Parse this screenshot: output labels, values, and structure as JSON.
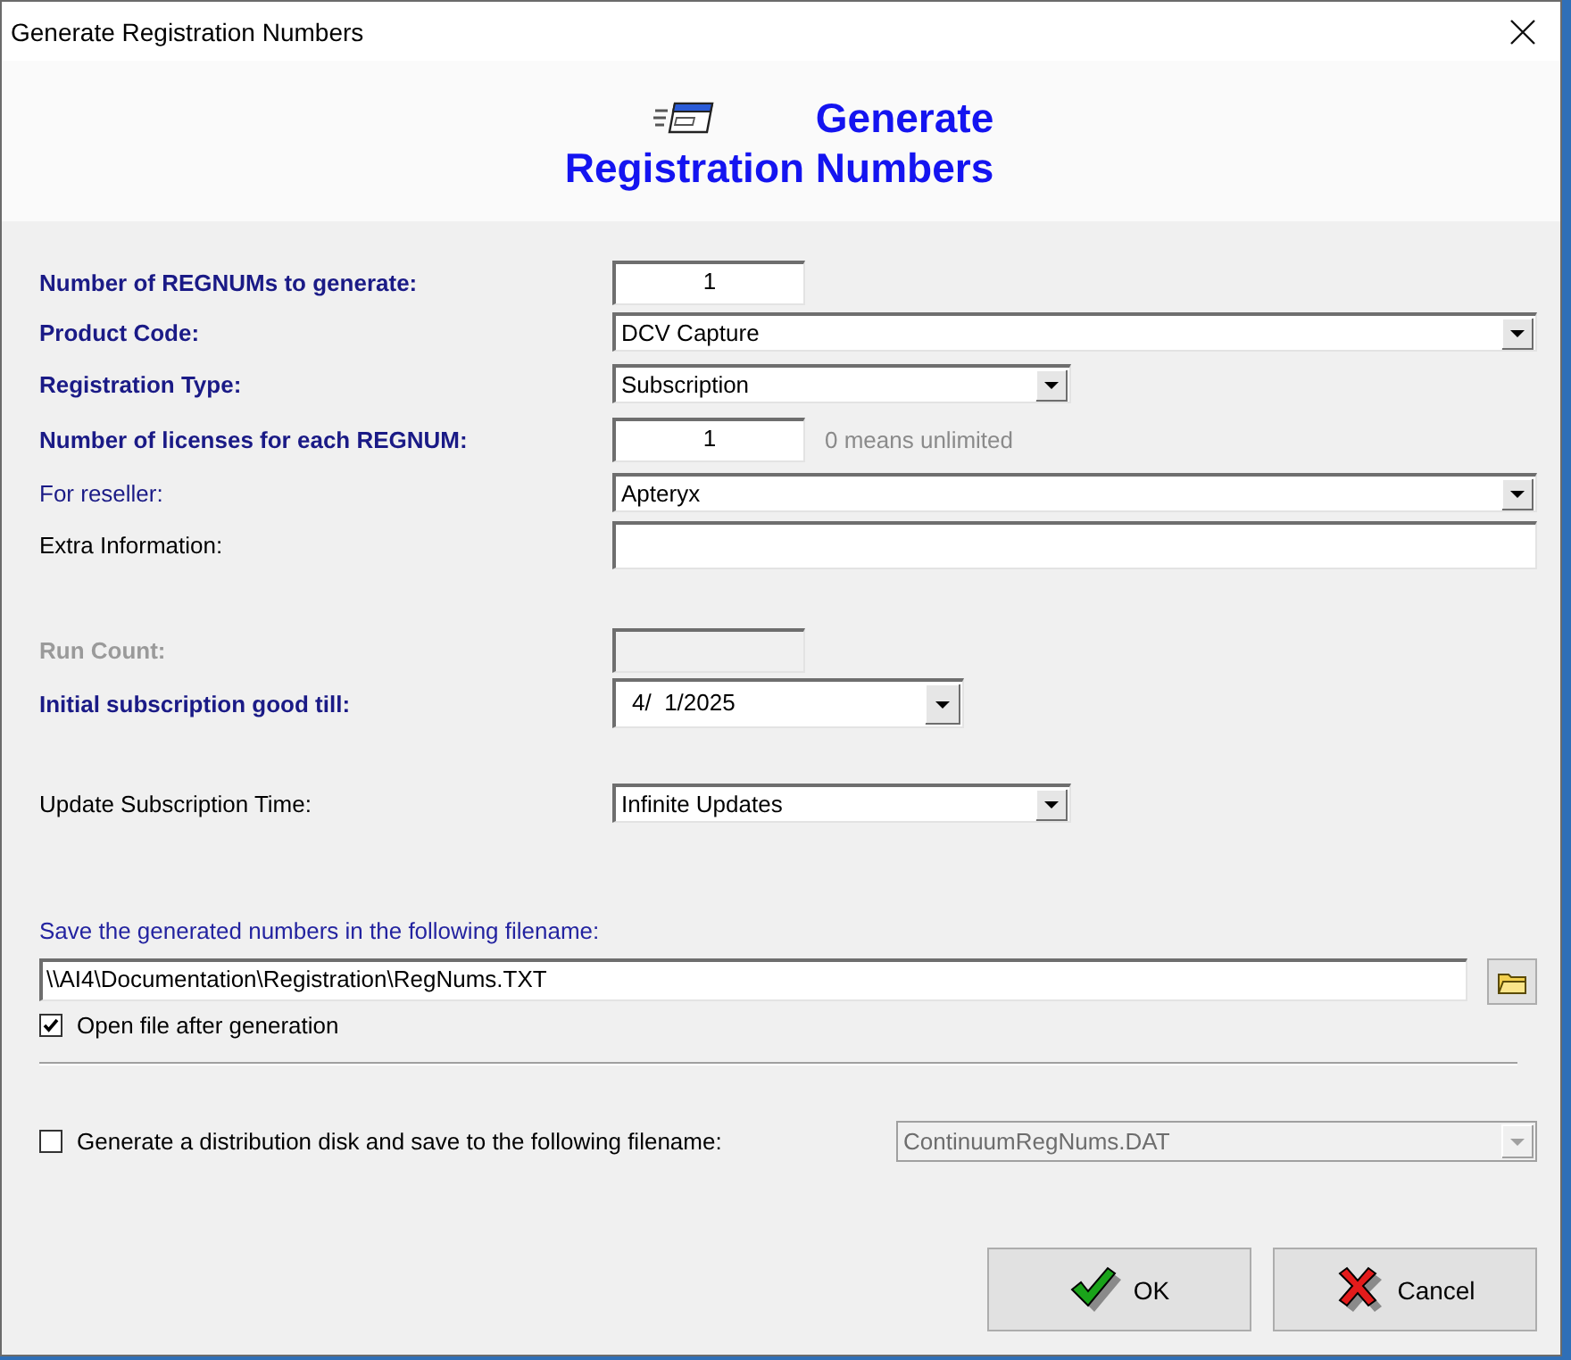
{
  "window": {
    "title": "Generate Registration Numbers"
  },
  "header": {
    "title_lines": [
      "Generate",
      "Registration Numbers"
    ]
  },
  "fields": [
    {
      "label": "Number of REGNUMs to generate:",
      "bold": true,
      "accent": true,
      "kind": "number",
      "value": "1",
      "disabled": false
    },
    {
      "label": "Product Code:",
      "bold": true,
      "accent": true,
      "kind": "dropdown",
      "value": "DCV Capture",
      "disabled": false
    },
    {
      "label": "Registration Type:",
      "bold": true,
      "accent": true,
      "kind": "dropdown",
      "value": "Subscription",
      "disabled": false
    },
    {
      "label": "Number of licenses for each REGNUM:",
      "bold": true,
      "accent": true,
      "kind": "number",
      "value": "1",
      "hint": "0 means unlimited",
      "disabled": false
    },
    {
      "label": "For reseller:",
      "bold": false,
      "accent": true,
      "kind": "dropdown",
      "value": "Apteryx",
      "disabled": false
    },
    {
      "label": "Extra Information:",
      "bold": false,
      "accent": false,
      "kind": "text",
      "disabled": false
    },
    {
      "label": "Run Count:",
      "bold": true,
      "accent": true,
      "kind": "number",
      "disabled": true
    },
    {
      "label": "Initial subscription good till:",
      "bold": true,
      "accent": true,
      "kind": "date",
      "value": "4/  1/2025",
      "disabled": false
    },
    {
      "label": "Update Subscription Time:",
      "bold": false,
      "accent": false,
      "kind": "dropdown",
      "value": "Infinite Updates",
      "disabled": false
    }
  ],
  "save": {
    "label": "Save the generated numbers in the following filename:",
    "path": "\\\\AI4\\Documentation\\Registration\\RegNums.TXT",
    "open_after": {
      "label": "Open file after generation",
      "checked": true
    }
  },
  "distribution": {
    "label": "Generate a distribution disk and save to the following filename:",
    "checked": false,
    "file": {
      "value": "ContinuumRegNums.DAT",
      "disabled": true
    }
  },
  "buttons": [
    {
      "kind": "ok",
      "label": "OK"
    },
    {
      "kind": "cancel",
      "label": "Cancel"
    }
  ]
}
